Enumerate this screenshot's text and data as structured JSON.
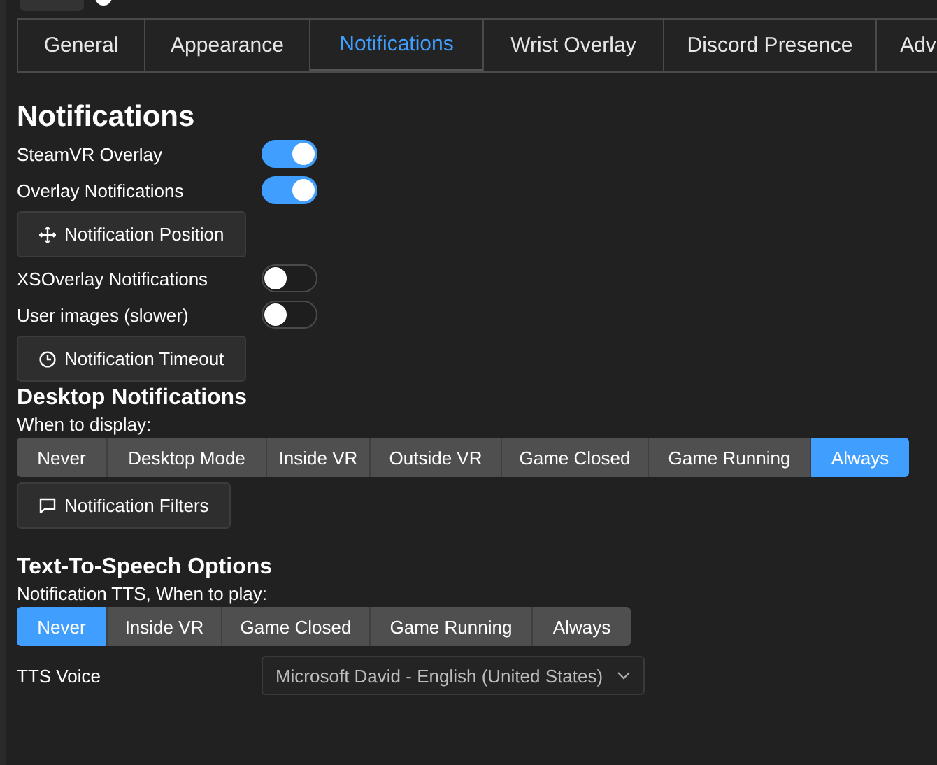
{
  "tabs": [
    {
      "label": "General",
      "selected": false
    },
    {
      "label": "Appearance",
      "selected": false
    },
    {
      "label": "Notifications",
      "selected": true
    },
    {
      "label": "Wrist Overlay",
      "selected": false
    },
    {
      "label": "Discord Presence",
      "selected": false
    },
    {
      "label": "Adv",
      "selected": false
    }
  ],
  "title": "Notifications",
  "settings": [
    {
      "kind": "toggle",
      "label": "SteamVR Overlay",
      "on": true
    },
    {
      "kind": "toggle",
      "label": "Overlay Notifications",
      "on": true
    },
    {
      "kind": "button",
      "label": "Notification Position"
    },
    {
      "kind": "toggle",
      "label": "XSOverlay Notifications",
      "on": false
    },
    {
      "kind": "toggle",
      "label": "User images (slower)",
      "on": false
    },
    {
      "kind": "button",
      "label": "Notification Timeout"
    }
  ],
  "desktop": {
    "heading": "Desktop Notifications",
    "prompt": "When to display:",
    "options": [
      {
        "label": "Never",
        "selected": false
      },
      {
        "label": "Desktop Mode",
        "selected": false
      },
      {
        "label": "Inside VR",
        "selected": false
      },
      {
        "label": "Outside VR",
        "selected": false
      },
      {
        "label": "Game Closed",
        "selected": false
      },
      {
        "label": "Game Running",
        "selected": false
      },
      {
        "label": "Always",
        "selected": true
      }
    ],
    "filter_button": "Notification Filters"
  },
  "tts": {
    "heading": "Text-To-Speech Options",
    "prompt": "Notification TTS, When to play:",
    "options": [
      {
        "label": "Never",
        "selected": true
      },
      {
        "label": "Inside VR",
        "selected": false
      },
      {
        "label": "Game Closed",
        "selected": false
      },
      {
        "label": "Game Running",
        "selected": false
      },
      {
        "label": "Always",
        "selected": false
      }
    ],
    "voice_label": "TTS Voice",
    "voice": "Microsoft David - English (United States)"
  }
}
